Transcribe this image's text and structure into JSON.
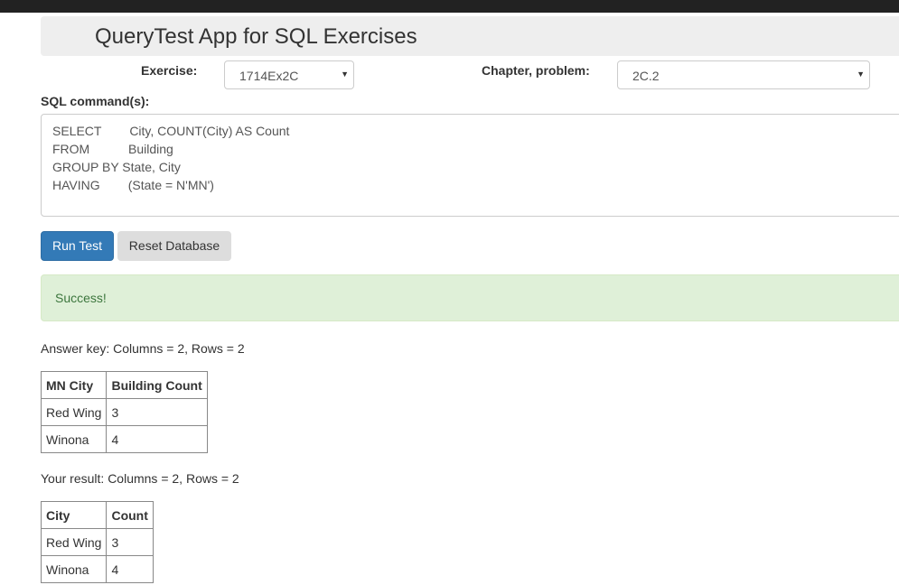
{
  "header": {
    "title": "QueryTest App for SQL Exercises"
  },
  "exercise": {
    "label": "Exercise:",
    "selected": "1714Ex2C"
  },
  "chapter": {
    "label": "Chapter, problem:",
    "selected": "2C.2"
  },
  "sql": {
    "label": "SQL command(s):",
    "text": "SELECT        City, COUNT(City) AS Count\nFROM           Building\nGROUP BY State, City\nHAVING        (State = N'MN')"
  },
  "buttons": {
    "run": "Run Test",
    "reset": "Reset Database"
  },
  "status": {
    "message": "Success!",
    "color": "#dff0d8"
  },
  "answer_key": {
    "summary": "Answer key: Columns = 2, Rows = 2",
    "headers": [
      "MN City",
      "Building Count"
    ],
    "rows": [
      [
        "Red Wing",
        "3"
      ],
      [
        "Winona",
        "4"
      ]
    ]
  },
  "your_result": {
    "summary": "Your result: Columns = 2, Rows = 2",
    "headers": [
      "City",
      "Count"
    ],
    "rows": [
      [
        "Red Wing",
        "3"
      ],
      [
        "Winona",
        "4"
      ]
    ]
  },
  "icons": {
    "dropdown": "chevron-down-icon"
  }
}
